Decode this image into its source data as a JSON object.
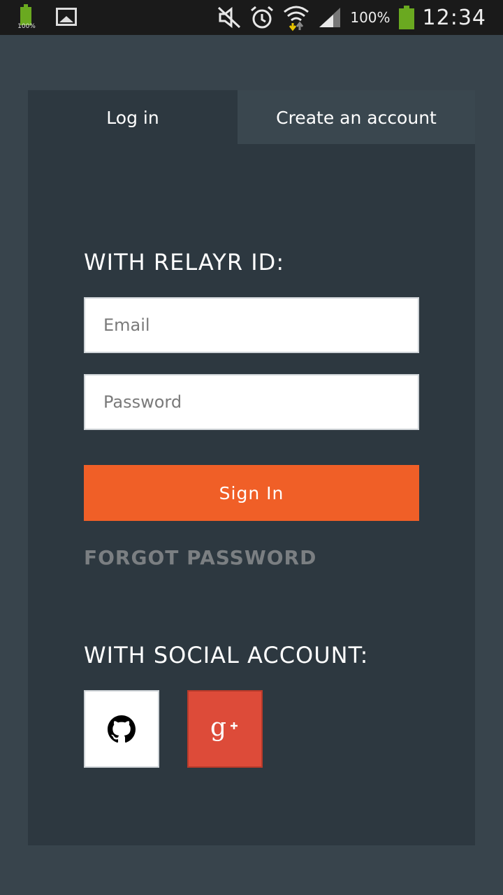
{
  "status_bar": {
    "battery_small_label": "100%",
    "battery_percent": "100%",
    "time": "12:34",
    "icons": [
      "battery-icon",
      "image-icon",
      "mute-icon",
      "alarm-icon",
      "wifi-icon",
      "signal-icon",
      "battery-icon"
    ]
  },
  "tabs": {
    "login": "Log in",
    "create": "Create an account"
  },
  "login_form": {
    "heading": "WITH RELAYR ID:",
    "email_placeholder": "Email",
    "email_value": "",
    "password_placeholder": "Password",
    "password_value": "",
    "sign_in_label": "Sign In",
    "forgot_password_label": "FORGOT PASSWORD"
  },
  "social": {
    "heading": "WITH SOCIAL ACCOUNT:",
    "providers": [
      {
        "icon": "github-icon"
      },
      {
        "icon": "google-plus-icon"
      }
    ]
  },
  "colors": {
    "page_background": "#38444c",
    "card_background": "#2d3840",
    "inactive_tab": "#3a474f",
    "accent": "#f05f27",
    "google_red": "#dd4b39",
    "muted_text": "#7b7f82"
  }
}
